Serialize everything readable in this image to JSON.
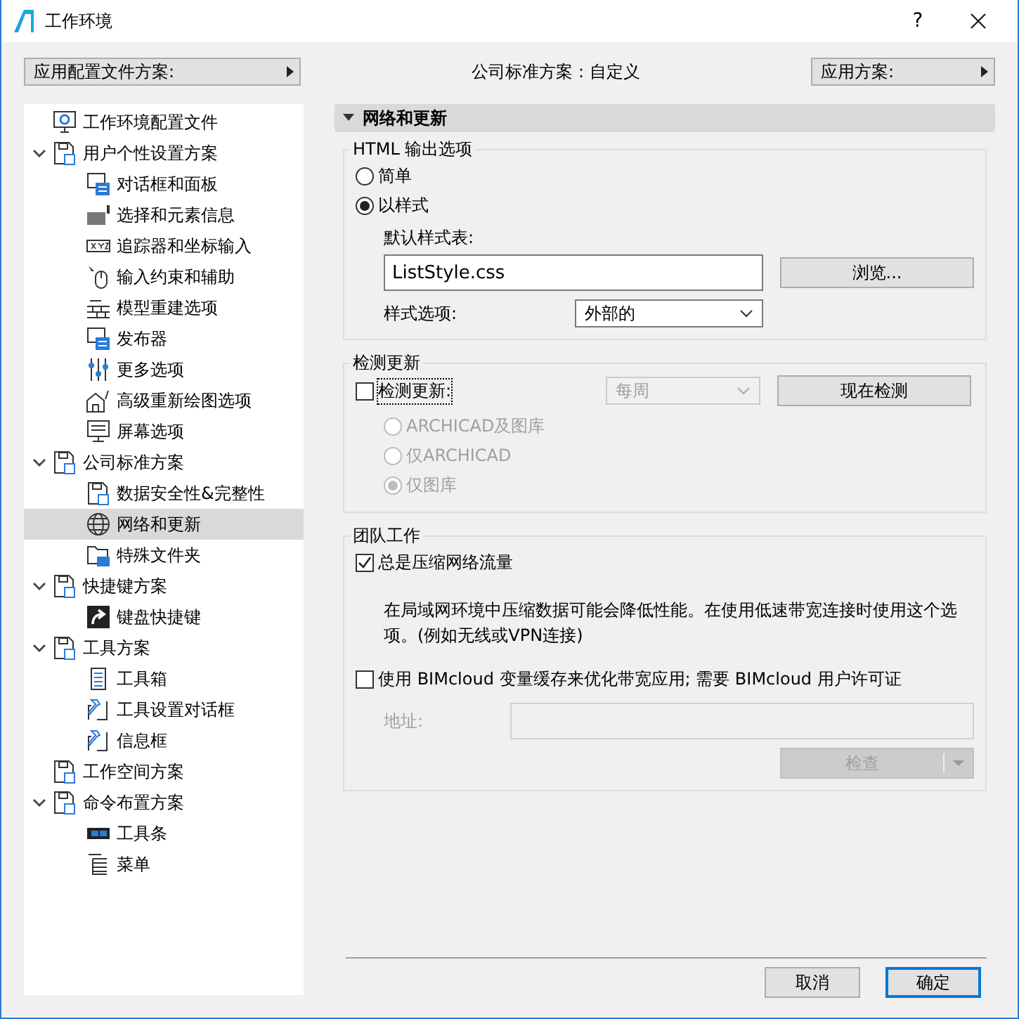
{
  "window": {
    "title": "工作环境",
    "help": "?"
  },
  "toolbar": {
    "left_menu": "应用配置文件方案:",
    "center_label": "公司标准方案：自定义",
    "right_menu": "应用方案:"
  },
  "tree": [
    {
      "label": "工作环境配置文件",
      "selected": false
    },
    {
      "label": "用户个性设置方案",
      "selected": false,
      "expanded": true,
      "children": [
        {
          "label": "对话框和面板",
          "selected": false
        },
        {
          "label": "选择和元素信息",
          "selected": false
        },
        {
          "label": "追踪器和坐标输入",
          "selected": false
        },
        {
          "label": "输入约束和辅助",
          "selected": false
        },
        {
          "label": "模型重建选项",
          "selected": false
        },
        {
          "label": "发布器",
          "selected": false
        },
        {
          "label": "更多选项",
          "selected": false
        },
        {
          "label": "高级重新绘图选项",
          "selected": false
        },
        {
          "label": "屏幕选项",
          "selected": false
        }
      ]
    },
    {
      "label": "公司标准方案",
      "selected": false,
      "expanded": true,
      "children": [
        {
          "label": "数据安全性&完整性",
          "selected": false
        },
        {
          "label": "网络和更新",
          "selected": true
        },
        {
          "label": "特殊文件夹",
          "selected": false
        }
      ]
    },
    {
      "label": "快捷键方案",
      "selected": false,
      "expanded": true,
      "children": [
        {
          "label": "键盘快捷键",
          "selected": false
        }
      ]
    },
    {
      "label": "工具方案",
      "selected": false,
      "expanded": true,
      "children": [
        {
          "label": "工具箱",
          "selected": false
        },
        {
          "label": "工具设置对话框",
          "selected": false
        },
        {
          "label": "信息框",
          "selected": false
        }
      ]
    },
    {
      "label": "工作空间方案",
      "selected": false
    },
    {
      "label": "命令布置方案",
      "selected": false,
      "expanded": true,
      "children": [
        {
          "label": "工具条",
          "selected": false
        },
        {
          "label": "菜单",
          "selected": false
        }
      ]
    }
  ],
  "panel": {
    "title": "网络和更新",
    "expanded": true
  },
  "html_group": {
    "title": "HTML 输出选项",
    "options": [
      {
        "label": "简单",
        "selected": false
      },
      {
        "label": "以样式",
        "selected": true
      }
    ],
    "stylesheet_label": "默认样式表:",
    "stylesheet_value": "ListStyle.css",
    "browse_button": "浏览...",
    "style_option_label": "样式选项:",
    "style_option_value": "外部的"
  },
  "update_group": {
    "title": "检测更新",
    "check": {
      "label": "检测更新:",
      "checked": false
    },
    "frequency": {
      "value": "每周",
      "disabled": true
    },
    "check_now_button": "现在检测",
    "sources": [
      {
        "label": "ARCHICAD及图库",
        "selected": false,
        "disabled": true
      },
      {
        "label": "仅ARCHICAD",
        "selected": false,
        "disabled": true
      },
      {
        "label": "仅图库",
        "selected": true,
        "disabled": true
      }
    ]
  },
  "team_group": {
    "title": "团队工作",
    "compress": {
      "label": "总是压缩网络流量",
      "checked": true
    },
    "note": "在局域网环境中压缩数据可能会降低性能。在使用低速带宽连接时使用这个选项。(例如无线或VPN连接)",
    "bimcloud": {
      "label": "使用 BIMcloud 变量缓存来优化带宽应用; 需要 BIMcloud 用户许可证",
      "checked": false
    },
    "address": {
      "label": "地址:",
      "disabled": true
    },
    "check_button": {
      "label": "检查",
      "disabled": true
    }
  },
  "buttons": [
    {
      "label": "取消",
      "default": false
    },
    {
      "label": "确定",
      "default": true
    }
  ]
}
